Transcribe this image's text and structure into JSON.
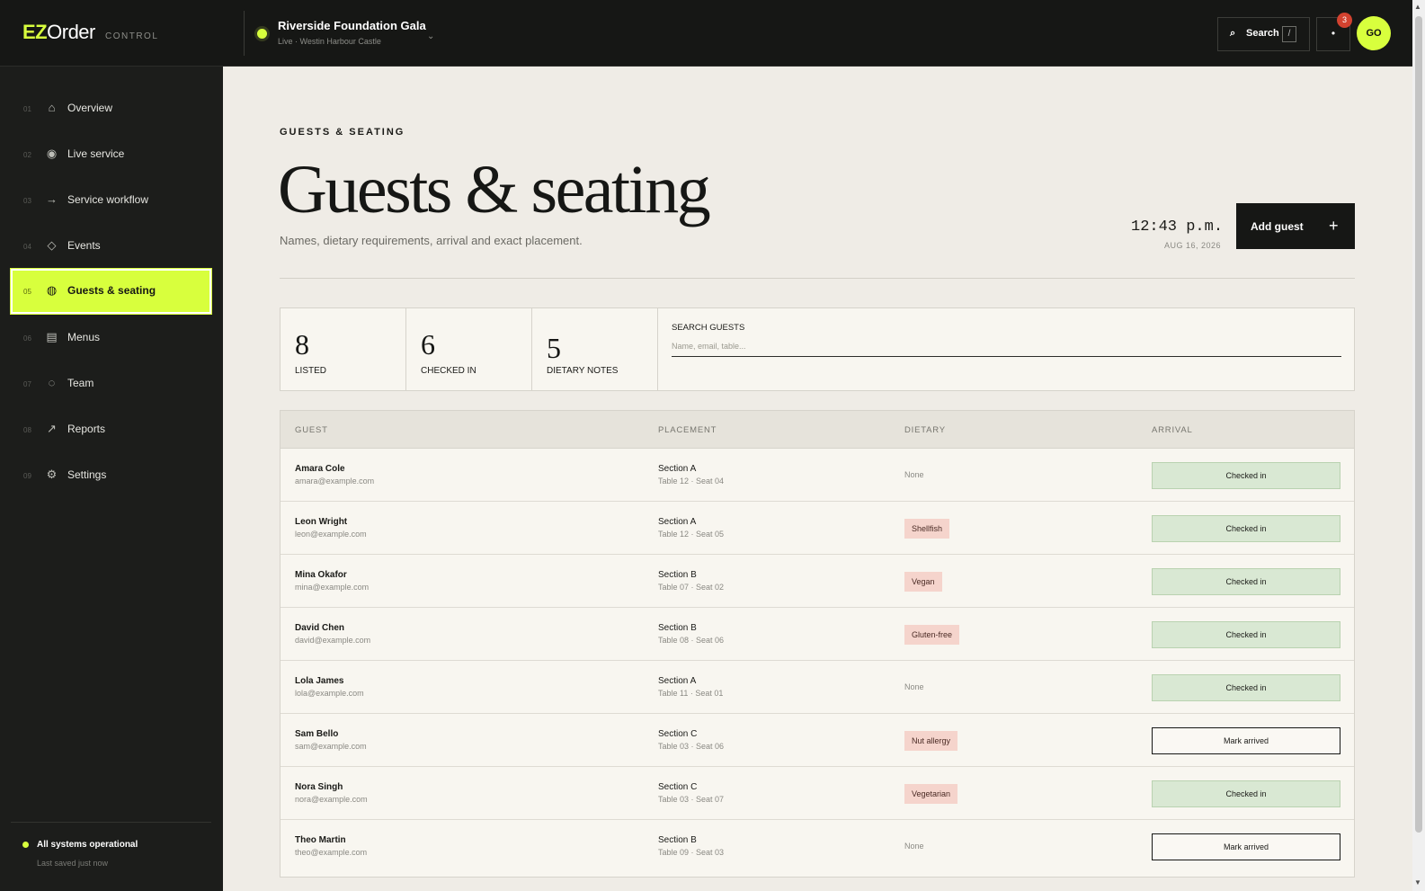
{
  "app": {
    "logo_a": "EZ",
    "logo_b": "Order",
    "logo_sub": "CONTROL"
  },
  "event": {
    "name": "Riverside Foundation Gala",
    "sub": "Live · Westin Harbour Castle"
  },
  "topbar": {
    "search_icon": "⌕",
    "search_label": "Search",
    "search_key": "/",
    "notif_icon": "•",
    "notif_count": "3",
    "avatar": "GO"
  },
  "nav": {
    "items": [
      {
        "num": "01",
        "icon": "⌂",
        "label": "Overview"
      },
      {
        "num": "02",
        "icon": "◉",
        "label": "Live service"
      },
      {
        "num": "03",
        "icon": "→",
        "label": "Service workflow"
      },
      {
        "num": "04",
        "icon": "◇",
        "label": "Events"
      },
      {
        "num": "05",
        "icon": "◍",
        "label": "Guests & seating"
      },
      {
        "num": "06",
        "icon": "▤",
        "label": "Menus"
      },
      {
        "num": "07",
        "icon": "◌",
        "label": "Team"
      },
      {
        "num": "08",
        "icon": "↗",
        "label": "Reports"
      },
      {
        "num": "09",
        "icon": "⚙",
        "label": "Settings"
      }
    ],
    "status_text": "All systems operational",
    "status_sub": "Last saved just now"
  },
  "page": {
    "eyebrow": "GUESTS & SEATING",
    "title": "Guests & seating",
    "subtitle": "Names, dietary requirements, arrival and exact placement.",
    "time": "12:43 p.m.",
    "date": "AUG 16, 2026",
    "add_label": "Add guest",
    "add_icon": "+"
  },
  "stats": [
    {
      "value": "8",
      "label": "LISTED"
    },
    {
      "value": "6",
      "label": "CHECKED IN"
    },
    {
      "value": "5",
      "label": "DIETARY NOTES"
    }
  ],
  "search": {
    "label": "SEARCH GUESTS",
    "placeholder": "Name, email, table..."
  },
  "table": {
    "headers": [
      "GUEST",
      "PLACEMENT",
      "DIETARY",
      "ARRIVAL"
    ],
    "rows": [
      {
        "name": "Amara Cole",
        "email": "amara@example.com",
        "section": "Section A",
        "seat": "Table 12 · Seat 04",
        "dietary": "None",
        "arrival": "Checked in"
      },
      {
        "name": "Leon Wright",
        "email": "leon@example.com",
        "section": "Section A",
        "seat": "Table 12 · Seat 05",
        "dietary": "Shellfish",
        "arrival": "Checked in"
      },
      {
        "name": "Mina Okafor",
        "email": "mina@example.com",
        "section": "Section B",
        "seat": "Table 07 · Seat 02",
        "dietary": "Vegan",
        "arrival": "Checked in"
      },
      {
        "name": "David Chen",
        "email": "david@example.com",
        "section": "Section B",
        "seat": "Table 08 · Seat 06",
        "dietary": "Gluten-free",
        "arrival": "Checked in"
      },
      {
        "name": "Lola James",
        "email": "lola@example.com",
        "section": "Section A",
        "seat": "Table 11 · Seat 01",
        "dietary": "None",
        "arrival": "Checked in"
      },
      {
        "name": "Sam Bello",
        "email": "sam@example.com",
        "section": "Section C",
        "seat": "Table 03 · Seat 06",
        "dietary": "Nut allergy",
        "arrival": "Mark arrived"
      },
      {
        "name": "Nora Singh",
        "email": "nora@example.com",
        "section": "Section C",
        "seat": "Table 03 · Seat 07",
        "dietary": "Vegetarian",
        "arrival": "Checked in"
      },
      {
        "name": "Theo Martin",
        "email": "theo@example.com",
        "section": "Section B",
        "seat": "Table 09 · Seat 03",
        "dietary": "None",
        "arrival": "Mark arrived"
      }
    ]
  },
  "colors": {
    "accent": "#d8ff3d",
    "dark": "#161715",
    "checked_bg": "#d9e8d3",
    "diet_tag_bg": "#f5d4cc",
    "badge": "#d2422f"
  }
}
